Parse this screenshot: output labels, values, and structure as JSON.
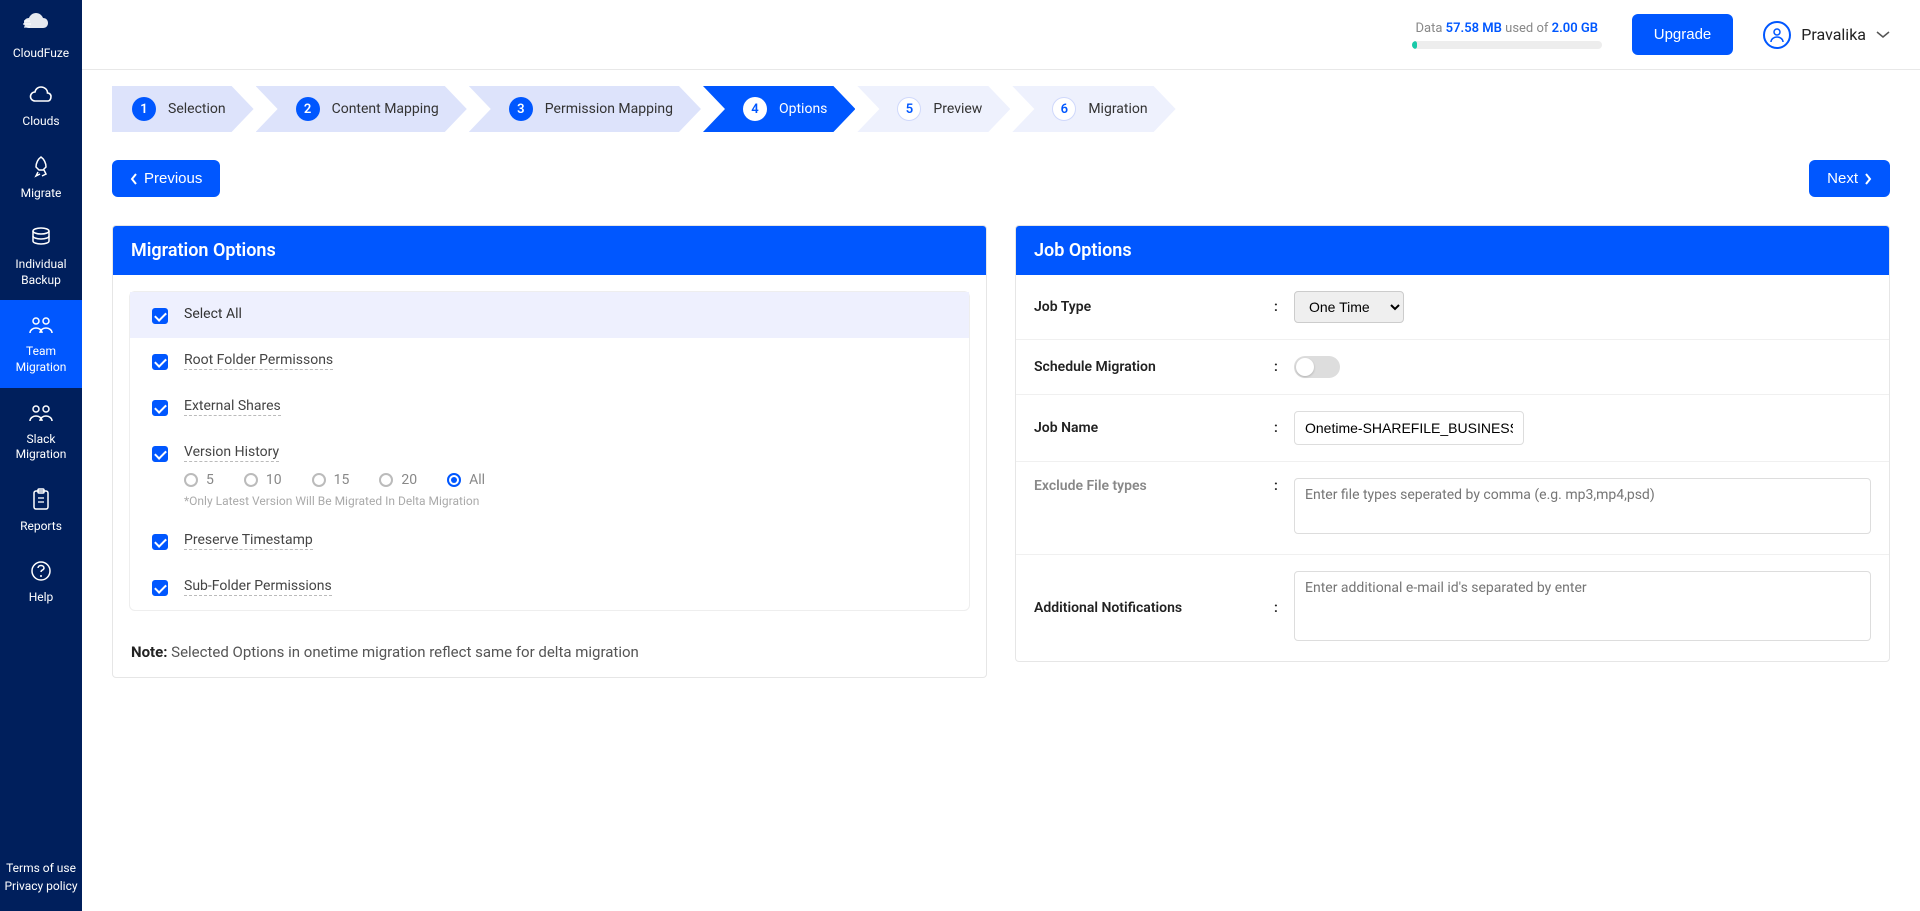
{
  "brand": "CloudFuze",
  "sidebar": {
    "items": [
      {
        "label": "Clouds"
      },
      {
        "label": "Migrate"
      },
      {
        "label": "Individual Backup"
      },
      {
        "label": "Team Migration"
      },
      {
        "label": "Slack Migration"
      },
      {
        "label": "Reports"
      },
      {
        "label": "Help"
      }
    ],
    "terms": "Terms of use",
    "privacy": "Privacy policy"
  },
  "topbar": {
    "data_prefix": "Data ",
    "data_used": "57.58 MB",
    "data_mid": " used of ",
    "data_total": "2.00 GB",
    "upgrade": "Upgrade",
    "user": "Pravalika"
  },
  "stepper": [
    {
      "num": "1",
      "label": "Selection"
    },
    {
      "num": "2",
      "label": "Content Mapping"
    },
    {
      "num": "3",
      "label": "Permission Mapping"
    },
    {
      "num": "4",
      "label": "Options"
    },
    {
      "num": "5",
      "label": "Preview"
    },
    {
      "num": "6",
      "label": "Migration"
    }
  ],
  "nav": {
    "prev": "Previous",
    "next": "Next"
  },
  "migration_panel": {
    "title": "Migration Options",
    "select_all": "Select All",
    "items": [
      "Root Folder Permissons",
      "External Shares",
      "Version History",
      "Preserve Timestamp",
      "Sub-Folder Permissions"
    ],
    "versions": [
      "5",
      "10",
      "15",
      "20",
      "All"
    ],
    "version_hint": "*Only Latest Version Will Be Migrated In Delta Migration",
    "note_label": "Note:",
    "note_text": " Selected Options in onetime migration reflect same for delta migration"
  },
  "job_panel": {
    "title": "Job Options",
    "rows": {
      "job_type": "Job Type",
      "job_type_value": "One Time",
      "schedule": "Schedule Migration",
      "job_name": "Job Name",
      "job_name_value": "Onetime-SHAREFILE_BUSINESS-GSUITE",
      "exclude": "Exclude File types",
      "exclude_placeholder": "Enter file types seperated by comma (e.g. mp3,mp4,psd)",
      "notify": "Additional Notifications",
      "notify_placeholder": "Enter additional e-mail id's separated by enter"
    }
  }
}
